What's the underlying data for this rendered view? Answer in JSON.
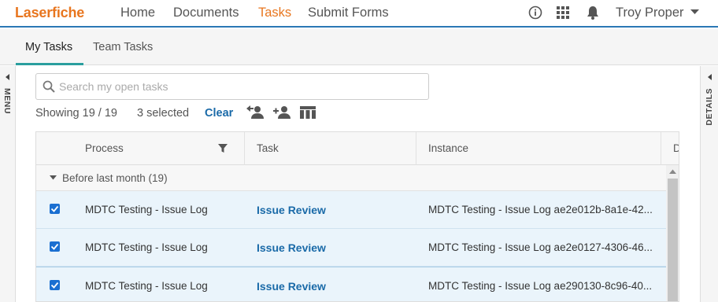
{
  "app": {
    "logo": "Laserfiche"
  },
  "nav": {
    "home": "Home",
    "documents": "Documents",
    "tasks": "Tasks",
    "submit_forms": "Submit Forms"
  },
  "user": {
    "name": "Troy Proper"
  },
  "tabs": {
    "my_tasks": "My Tasks",
    "team_tasks": "Team Tasks"
  },
  "rails": {
    "left": "MENU",
    "right": "DETAILS"
  },
  "search": {
    "placeholder": "Search my open tasks",
    "value": ""
  },
  "toolbar": {
    "showing": "Showing 19 / 19",
    "selected": "3 selected",
    "clear": "Clear"
  },
  "columns": {
    "process": "Process",
    "task": "Task",
    "instance": "Instance",
    "next": "D"
  },
  "group": {
    "label": "Before last month (19)"
  },
  "rows": [
    {
      "checked": true,
      "process": "MDTC Testing - Issue Log",
      "task": "Issue Review",
      "instance": "MDTC Testing - Issue Log ae2e012b-8a1e-42..."
    },
    {
      "checked": true,
      "process": "MDTC Testing - Issue Log",
      "task": "Issue Review",
      "instance": "MDTC Testing - Issue Log ae2e0127-4306-46..."
    },
    {
      "checked": true,
      "process": "MDTC Testing - Issue Log",
      "task": "Issue Review",
      "instance": "MDTC Testing - Issue Log ae290130-8c96-40..."
    }
  ],
  "colors": {
    "brand": "#e8761f",
    "accent": "#1a6aa8",
    "tab_underline": "#2a9e9e",
    "selected_row": "#eaf4fb"
  },
  "icons": [
    "info-icon",
    "apps-grid-icon",
    "bell-icon",
    "caret-down-icon",
    "search-icon",
    "reassign-user-icon",
    "assign-user-icon",
    "columns-icon",
    "filter-icon"
  ]
}
